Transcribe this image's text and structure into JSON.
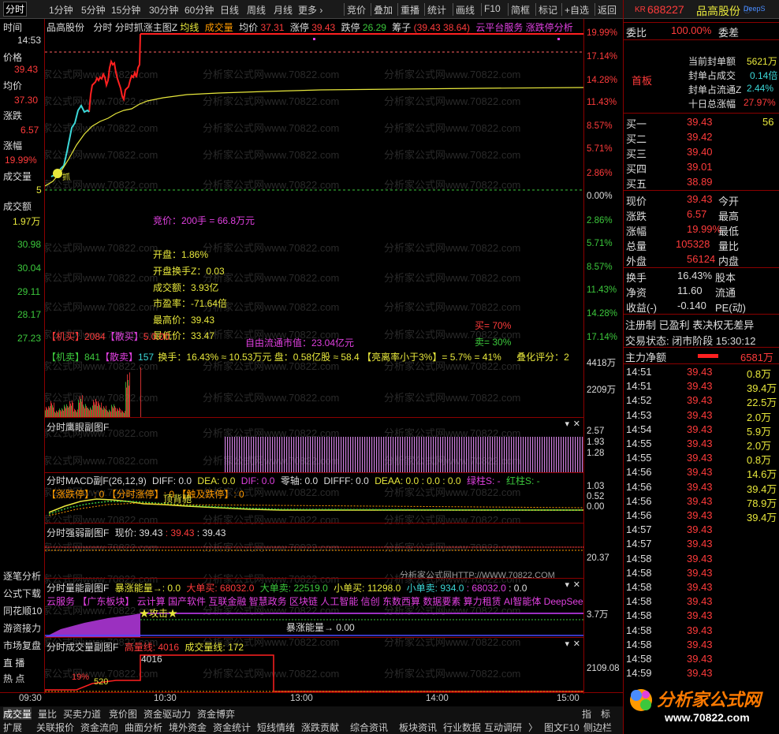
{
  "topbar": {
    "periods": [
      "分时",
      "1分钟",
      "5分钟",
      "15分钟",
      "30分钟",
      "60分钟",
      "日线",
      "周线",
      "月线",
      "更多 ›"
    ],
    "tools": [
      "竞价",
      "叠加",
      "重播",
      "统计",
      "画线",
      "F10",
      "简框",
      "标记",
      "+自选",
      "返回"
    ]
  },
  "left": {
    "time_label": "时间",
    "time": "14:53",
    "price_label": "价格",
    "price": "39.43",
    "avg_label": "均价",
    "avg": "37.30",
    "change_label": "涨跌",
    "change": "6.57",
    "pct_label": "涨幅",
    "pct": "19.99%",
    "vol_label": "成交量",
    "vol": "5",
    "amt_label": "成交额",
    "amt": "1.97万",
    "ticks": [
      "30.98",
      "30.04",
      "29.11",
      "28.17",
      "27.23"
    ]
  },
  "chart": {
    "title_name": "品高股份",
    "title_rest": "分时 分时抓涨主图Z",
    "legend_avg": "均线",
    "legend_vol": "成交量",
    "avg_label": "均价",
    "avg_val": "37.31",
    "limit_up_label": "涨停",
    "limit_up_val": "39.43",
    "limit_down_label": "跌停",
    "limit_down_val": "26.29",
    "chip_label": "筹子",
    "chip_val": "(39.43 38.64)",
    "scroll_text": "云平台服务 涨跌停分析",
    "pct_ticks": [
      "19.99%",
      "17.14%",
      "14.28%",
      "11.43%",
      "8.57%",
      "5.71%",
      "2.86%",
      "0.00%",
      "2.86%",
      "5.71%",
      "8.57%",
      "11.43%",
      "14.28%",
      "17.14%"
    ],
    "auction": "竞价：200手 = 66.8万元",
    "open_pct": "开盘：1.86%",
    "open_turn": "开盘换手Z：0.03",
    "turnover": "成交额：3.93亿",
    "pe": "市盈率：-71.64倍",
    "high": "最高价：39.43",
    "low": "最低价：33.47",
    "buy_pct": "买= 70%",
    "sell_pct": "卖= 30%",
    "float_cap": "自由流通市值：23.04亿元",
    "jimai": "【机买】2084",
    "jimai2": "【散买】",
    "jimai_val": "5.0.00",
    "jimai3": "【机卖】841",
    "jimai4": "【散卖】",
    "jimai4_val": "157",
    "huanshou": "换手：16.43% ≈ 10.53万元",
    "panzi": "盘：0.58亿股 ≈ 58.4",
    "xiaolv": "【亮离率小于3%】= 5.7%",
    "lv41": "= 41%",
    "pingfen": "叠化评分：2",
    "vol_ticks": [
      "4418万",
      "2209万"
    ]
  },
  "eagle": {
    "title": "分时鹰眼副图F",
    "ticks": [
      "2.57",
      "1.93",
      "1.28"
    ]
  },
  "macd": {
    "title": "分时MACD副F(26,12,9)",
    "diff": "DIFF: 0.0",
    "dea": "DEA: 0.0",
    "dif": "DIF: 0.0",
    "zero": "零轴: 0.0",
    "difff": "DIFFF: 0.0",
    "deaa": "DEAA: 0.0 : 0.0 : 0.0",
    "green_col": "绿柱S: -",
    "red_col": "红柱S: -",
    "tags": "【涨跌停】: 0 【分时涨停】: 0 【触及跌停】: 0",
    "top_tag": "顶背驰",
    "ticks": [
      "1.03",
      "0.52",
      "0.00"
    ]
  },
  "strong": {
    "title": "分时强弱副图F",
    "now": "现价: 39.43",
    "v1": ": 39.43",
    "v2": ": 39.43",
    "tick": "20.37",
    "watermark": "分析家公式网HTTP://WWW.70822.COM"
  },
  "energy": {
    "title": "分时量能副图F",
    "burst": "暴涨能量→: 0.0",
    "big_buy": "大单买: 68032.0",
    "big_sell": "大单卖: 22519.0",
    "small_buy": "小单买: 11298.0",
    "small_sell": "小单卖: 934.0",
    "total": ": 68032.0",
    "end": ": 0.0",
    "concepts": "云服务 【广东板块】 云计算 国产软件 互联金融 智慧政务 区块链 人工智能 信创 东数西算 数据要素 算力租赁 AI智能体 DeepSeek",
    "attack": "★攻击★",
    "burst2": "暴涨能量→ 0.00",
    "tick": "3.7万"
  },
  "volpanel": {
    "title": "分时成交量副图F",
    "high_label": "高量线: 4016",
    "vol_label": "成交量线: 172",
    "peak": "4016",
    "tick": "2109.08",
    "mark": "19%",
    "mark2": "520"
  },
  "sidelinks": [
    "逐笔分析",
    "公式下载",
    "同花顺10",
    "游资接力",
    "市场复盘",
    "直 播",
    "热 点"
  ],
  "time_axis": [
    "09:30",
    "10:30",
    "13:00",
    "14:00",
    "15:00"
  ],
  "bottom1": [
    "成交量",
    "量比",
    "买卖力道",
    "竞价图",
    "资金驱动力",
    "资金博弈"
  ],
  "bottom2": [
    "扩展",
    "关联报价",
    "资金流向",
    "曲面分析",
    "境外资金",
    "资金统计",
    "短线情绪",
    "涨跌贡献",
    "综合资讯",
    "板块资讯",
    "行业数据",
    "互动调研",
    "〉",
    "图文F10",
    "侧边栏"
  ],
  "bottom_right": [
    "指",
    "标"
  ],
  "panel": {
    "market_tag": "KR",
    "code": "688227",
    "name": "品高股份",
    "deepseek": "DeepS",
    "weibi_label": "委比",
    "weibi": "100.00%",
    "weicha_label": "委差",
    "board": "首板",
    "seal_amt_label": "当前封单额",
    "seal_amt": "5621万",
    "seal_vol_label": "封单占成交",
    "seal_vol": "0.14倍",
    "seal_float_label": "封单占流通Z",
    "seal_float": "2.44%",
    "ten_day_label": "十日总涨幅",
    "ten_day": "27.97%",
    "buys": [
      {
        "label": "买一",
        "price": "39.43",
        "vol": "56"
      },
      {
        "label": "买二",
        "price": "39.42",
        "vol": ""
      },
      {
        "label": "买三",
        "price": "39.40",
        "vol": ""
      },
      {
        "label": "买四",
        "price": "39.01",
        "vol": ""
      },
      {
        "label": "买五",
        "price": "38.89",
        "vol": ""
      }
    ],
    "quote": [
      {
        "l": "现价",
        "v": "39.43",
        "r": "今开"
      },
      {
        "l": "涨跌",
        "v": "6.57",
        "r": "最高"
      },
      {
        "l": "涨幅",
        "v": "19.99%",
        "r": "最低"
      },
      {
        "l": "总量",
        "v": "105328",
        "r": "量比"
      },
      {
        "l": "外盘",
        "v": "56124",
        "r": "内盘"
      }
    ],
    "stats": [
      {
        "l": "换手",
        "v": "16.43%",
        "r": "股本"
      },
      {
        "l": "净资",
        "v": "11.60",
        "r": "流通"
      },
      {
        "l": "收益(-)",
        "v": "-0.140",
        "r": "PE(动)"
      }
    ],
    "reg": "注册制 已盈利 表决权无差异",
    "trade_state": "交易状态: 闭市阶段 15:30:12",
    "main_flow_label": "主力净额",
    "main_flow": "6581万",
    "ticks": [
      {
        "t": "14:51",
        "p": "39.43",
        "v": "0.8万"
      },
      {
        "t": "14:51",
        "p": "39.43",
        "v": "39.4万"
      },
      {
        "t": "14:52",
        "p": "39.43",
        "v": "22.5万"
      },
      {
        "t": "14:53",
        "p": "39.43",
        "v": "2.0万"
      },
      {
        "t": "14:54",
        "p": "39.43",
        "v": "5.9万"
      },
      {
        "t": "14:55",
        "p": "39.43",
        "v": "2.0万"
      },
      {
        "t": "14:55",
        "p": "39.43",
        "v": "0.8万"
      },
      {
        "t": "14:56",
        "p": "39.43",
        "v": "14.6万"
      },
      {
        "t": "14:56",
        "p": "39.43",
        "v": "39.4万"
      },
      {
        "t": "14:56",
        "p": "39.43",
        "v": "78.9万"
      },
      {
        "t": "14:56",
        "p": "39.43",
        "v": "39.4万"
      },
      {
        "t": "14:57",
        "p": "39.43",
        "v": ""
      },
      {
        "t": "14:57",
        "p": "39.43",
        "v": ""
      },
      {
        "t": "14:58",
        "p": "39.43",
        "v": ""
      },
      {
        "t": "14:58",
        "p": "39.43",
        "v": ""
      },
      {
        "t": "14:58",
        "p": "39.43",
        "v": ""
      },
      {
        "t": "14:58",
        "p": "39.43",
        "v": ""
      },
      {
        "t": "14:58",
        "p": "39.43",
        "v": ""
      },
      {
        "t": "14:58",
        "p": "39.43",
        "v": ""
      },
      {
        "t": "14:58",
        "p": "39.43",
        "v": ""
      },
      {
        "t": "14:58",
        "p": "39.43",
        "v": ""
      },
      {
        "t": "14:59",
        "p": "39.43",
        "v": ""
      },
      {
        "t": "14:59",
        "p": "39.43",
        "v": ""
      },
      {
        "t": "14:59",
        "p": "39.43",
        "v": ""
      }
    ],
    "logo_text": "分析家公式网",
    "logo_url": "www.70822.com"
  },
  "watermark": "分析家公式网www.70822.com"
}
